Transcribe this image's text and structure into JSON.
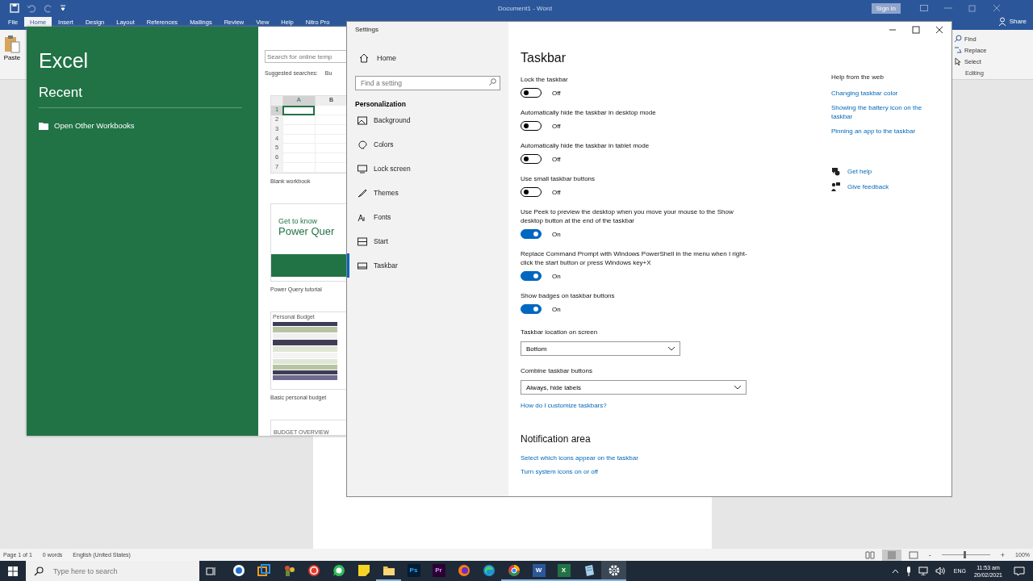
{
  "word": {
    "title": "Document1  -  Word",
    "sign_in": "Sign in",
    "share": "Share",
    "tabs": [
      {
        "label": "File",
        "selected": false
      },
      {
        "label": "Home",
        "selected": true
      },
      {
        "label": "Insert",
        "selected": false
      },
      {
        "label": "Design",
        "selected": false
      },
      {
        "label": "Layout",
        "selected": false
      },
      {
        "label": "References",
        "selected": false
      },
      {
        "label": "Mailings",
        "selected": false
      },
      {
        "label": "Review",
        "selected": false
      },
      {
        "label": "View",
        "selected": false
      },
      {
        "label": "Help",
        "selected": false
      },
      {
        "label": "Nitro Pro",
        "selected": false
      }
    ],
    "paste": "Paste",
    "editing": {
      "find": "Find",
      "replace": "Replace",
      "select": "Select",
      "group": "Editing"
    },
    "status_bar": {
      "page": "Page 1 of 1",
      "words": "0 words",
      "language": "English (United States)",
      "zoom_out": "-",
      "zoom_in": "+",
      "level": 0.48,
      "zoom": "100%"
    }
  },
  "excel": {
    "app": "Excel",
    "recent": "Recent",
    "open_other": "Open Other Workbooks",
    "search": {
      "placeholder": "Search for online temp"
    },
    "suggested": "Suggested searches:",
    "suggestion": "Bu",
    "templates": [
      {
        "kind": "blank",
        "columns": [
          "A",
          "B"
        ],
        "rows": [
          "1",
          "2",
          "3",
          "4",
          "5",
          "6",
          "7"
        ],
        "caption": "Blank workbook"
      },
      {
        "kind": "tour",
        "lines": [
          "Get to know",
          "Power Quer"
        ],
        "caption": "Power Query tutorial"
      },
      {
        "kind": "budget",
        "heading": "Personal Budget",
        "caption": "Basic personal budget"
      },
      {
        "kind": "overview",
        "heading": "BUDGET OVERVIEW"
      }
    ]
  },
  "settings": {
    "title": "Settings",
    "home": "Home",
    "search": {
      "placeholder": "Find a setting"
    },
    "section": "Personalization",
    "nav": [
      {
        "label": "Background",
        "selected": false
      },
      {
        "label": "Colors",
        "selected": false
      },
      {
        "label": "Lock screen",
        "selected": false
      },
      {
        "label": "Themes",
        "selected": false
      },
      {
        "label": "Fonts",
        "selected": false
      },
      {
        "label": "Start",
        "selected": false
      },
      {
        "label": "Taskbar",
        "selected": true
      }
    ],
    "page_title": "Taskbar",
    "items": [
      {
        "kind": "toggle",
        "label": "Lock the taskbar",
        "on": false,
        "state_text": "Off"
      },
      {
        "kind": "toggle",
        "label": "Automatically hide the taskbar in desktop mode",
        "on": false,
        "state_text": "Off"
      },
      {
        "kind": "toggle",
        "label": "Automatically hide the taskbar in tablet mode",
        "on": false,
        "state_text": "Off"
      },
      {
        "kind": "toggle",
        "label": "Use small taskbar buttons",
        "on": false,
        "state_text": "Off"
      },
      {
        "kind": "toggle",
        "label": "Use Peek to preview the desktop when you move your mouse to the Show desktop button at the end of the taskbar",
        "on": true,
        "state_text": "On"
      },
      {
        "kind": "toggle",
        "label": "Replace Command Prompt with Windows PowerShell in the menu when I right-click the start button or press Windows key+X",
        "on": true,
        "state_text": "On"
      },
      {
        "kind": "toggle",
        "label": "Show badges on taskbar buttons",
        "on": true,
        "state_text": "On"
      },
      {
        "kind": "dropdown",
        "label": "Taskbar location on screen",
        "value": "Bottom",
        "wide": false
      },
      {
        "kind": "dropdown",
        "label": "Combine taskbar buttons",
        "value": "Always, hide labels",
        "wide": true
      },
      {
        "kind": "link",
        "label": "How do I customize taskbars?"
      },
      {
        "kind": "heading",
        "label": "Notification area"
      },
      {
        "kind": "link",
        "label": "Select which icons appear on the taskbar"
      },
      {
        "kind": "link",
        "label": "Turn system icons on or off"
      }
    ],
    "help": {
      "title": "Help from the web",
      "links": [
        "Changing taskbar color",
        "Showing the battery icon on the taskbar",
        "Pinning an app to the taskbar"
      ],
      "get_help": "Get help",
      "feedback": "Give feedback"
    }
  },
  "taskbar": {
    "search": {
      "placeholder": "Type here to search"
    },
    "apps": [
      {
        "kind": "cortana",
        "running": false,
        "selected": false
      },
      {
        "kind": "boxes",
        "running": false,
        "selected": false
      },
      {
        "kind": "figure",
        "running": false,
        "selected": false
      },
      {
        "kind": "record",
        "running": false,
        "selected": false
      },
      {
        "kind": "chat",
        "running": false,
        "selected": false
      },
      {
        "kind": "note",
        "running": false,
        "selected": false
      },
      {
        "kind": "folder",
        "running": true,
        "selected": false
      },
      {
        "kind": "ps",
        "label": "Ps",
        "running": false,
        "selected": false
      },
      {
        "kind": "pr",
        "label": "Pr",
        "running": false,
        "selected": false
      },
      {
        "kind": "firefox",
        "running": false,
        "selected": false
      },
      {
        "kind": "edge",
        "running": false,
        "selected": false
      },
      {
        "kind": "chrome",
        "running": true,
        "selected": false
      },
      {
        "kind": "word",
        "label": "W",
        "running": true,
        "selected": false
      },
      {
        "kind": "excel",
        "label": "X",
        "running": true,
        "selected": false
      },
      {
        "kind": "notepad",
        "running": true,
        "selected": false
      },
      {
        "kind": "settings",
        "running": true,
        "selected": true
      }
    ],
    "language": "ENG",
    "time": "11:53 am",
    "date": "20/02/2021"
  }
}
